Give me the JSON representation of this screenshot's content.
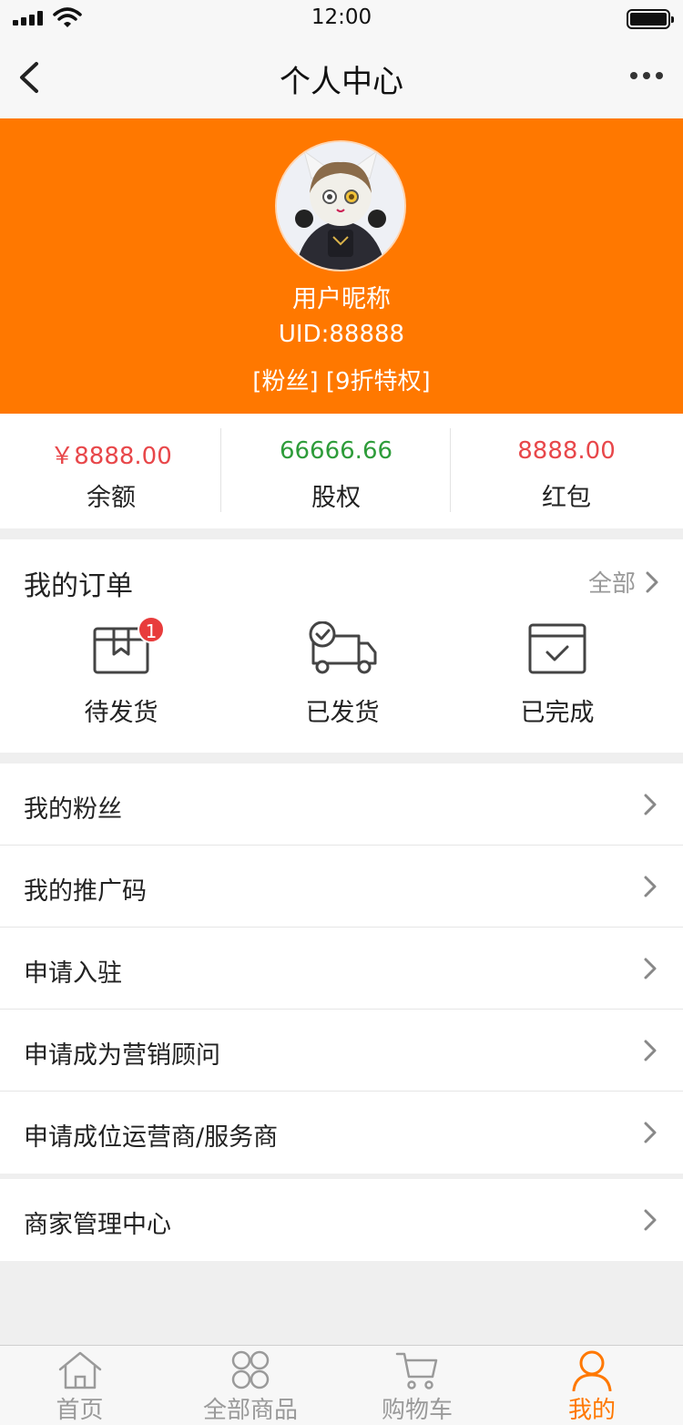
{
  "status_bar": {
    "time": "12:00"
  },
  "nav": {
    "title": "个人中心"
  },
  "profile": {
    "nickname": "用户昵称",
    "uid": "UID:88888",
    "tags": "[粉丝]  [9折特权]"
  },
  "stats": [
    {
      "value": "￥8888.00",
      "label": "余额",
      "color": "#e8474a"
    },
    {
      "value": "66666.66",
      "label": "股权",
      "color": "#2e9c3a"
    },
    {
      "value": "8888.00",
      "label": "红包",
      "color": "#e8474a"
    }
  ],
  "orders": {
    "title": "我的订单",
    "all_label": "全部",
    "items": [
      {
        "label": "待发货",
        "icon": "package-icon",
        "badge": "1"
      },
      {
        "label": "已发货",
        "icon": "delivery-truck-icon"
      },
      {
        "label": "已完成",
        "icon": "calendar-check-icon"
      }
    ]
  },
  "menu_group_1": [
    {
      "label": "我的粉丝"
    },
    {
      "label": "我的推广码"
    },
    {
      "label": "申请入驻"
    },
    {
      "label": "申请成为营销顾问"
    },
    {
      "label": "申请成位运营商/服务商"
    }
  ],
  "menu_group_2": [
    {
      "label": "商家管理中心"
    }
  ],
  "tab_bar": [
    {
      "label": "首页",
      "icon": "home-icon"
    },
    {
      "label": "全部商品",
      "icon": "all-products-icon"
    },
    {
      "label": "购物车",
      "icon": "cart-icon"
    },
    {
      "label": "我的",
      "icon": "user-icon",
      "active": true
    }
  ],
  "colors": {
    "brand": "#ff7800",
    "badge": "#e83c3c"
  }
}
